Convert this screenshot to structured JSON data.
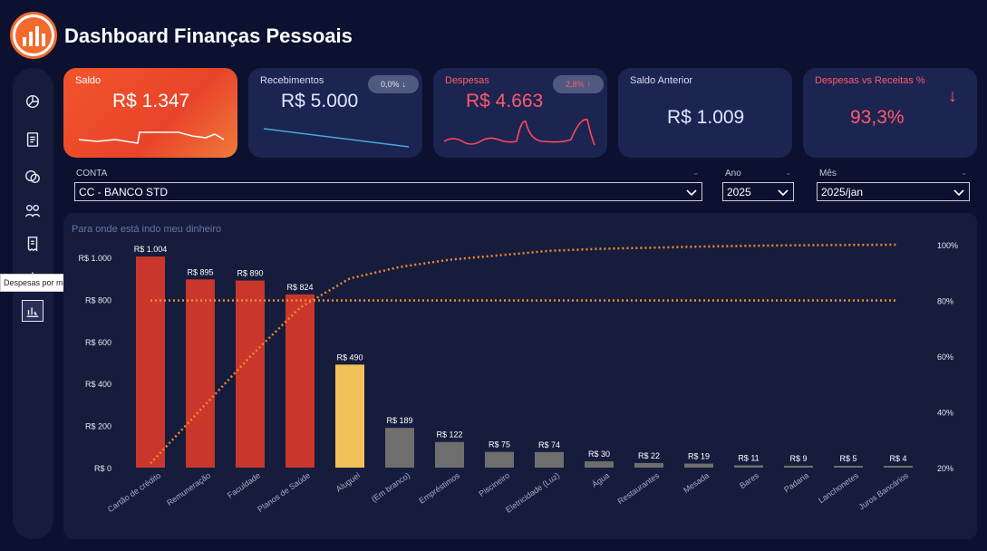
{
  "header": {
    "title": "Dashboard Finanças Pessoais",
    "logo_icon": "chart-logo-icon"
  },
  "sidebar": {
    "icons": [
      "pie-chart-icon",
      "document-icon",
      "coins-icon",
      "people-money-icon",
      "receipt-icon",
      "bar-chart-icon",
      "monthly-expenses-icon"
    ],
    "tooltip": "Despesas por mês"
  },
  "cards": {
    "saldo": {
      "label": "Saldo",
      "value": "R$ 1.347"
    },
    "recebimentos": {
      "label": "Recebimentos",
      "value": "R$ 5.000",
      "badge": "0,0%",
      "badge_icon": "arrow-down-icon"
    },
    "despesas": {
      "label": "Despesas",
      "value": "R$ 4.663",
      "badge": "2,8%",
      "badge_icon": "arrow-up-icon"
    },
    "saldo_anterior": {
      "label": "Saldo Anterior",
      "value": "R$ 1.009"
    },
    "despesas_receitas": {
      "label": "Despesas vs Receitas %",
      "value": "93,3%",
      "icon": "arrow-down-icon"
    }
  },
  "filters": {
    "conta": {
      "label": "CONTA",
      "value": "CC - BANCO STD"
    },
    "ano": {
      "label": "Ano",
      "value": "2025"
    },
    "mes": {
      "label": "Mês",
      "value": "2025/jan"
    }
  },
  "colors": {
    "accent": "#f26a2c",
    "bar_red": "#c9372c",
    "bar_yellow": "#f2c25a",
    "bar_gray": "#6e6e6e",
    "line": "#f08a2c",
    "panel": "#161c3c"
  },
  "chart_data": {
    "type": "bar",
    "title": "Para onde está indo meu dinheiro",
    "categories": [
      "Cartão de crédito",
      "Remuneração",
      "Faculdade",
      "Planos de Saúde",
      "Aluguel",
      "(Em branco)",
      "Empréstimos",
      "Piscineiro",
      "Eletricidade (Luz)",
      "Água",
      "Restaurantes",
      "Mesada",
      "Bares",
      "Padaria",
      "Lanchonetes",
      "Juros Bancários"
    ],
    "values": [
      1004,
      895,
      890,
      824,
      490,
      189,
      122,
      75,
      74,
      30,
      22,
      19,
      11,
      9,
      5,
      4
    ],
    "data_labels": [
      "R$ 1.004",
      "R$ 895",
      "R$ 890",
      "R$ 824",
      "R$ 490",
      "R$ 189",
      "R$ 122",
      "R$ 75",
      "R$ 74",
      "R$ 30",
      "R$ 22",
      "R$ 19",
      "R$ 11",
      "R$ 9",
      "R$ 5",
      "R$ 4"
    ],
    "bar_colors": [
      "red",
      "red",
      "red",
      "red",
      "yellow",
      "gray",
      "gray",
      "gray",
      "gray",
      "gray",
      "gray",
      "gray",
      "gray",
      "gray",
      "gray",
      "gray"
    ],
    "ylim": [
      0,
      1000
    ],
    "y_ticks": [
      "R$ 0",
      "R$ 200",
      "R$ 400",
      "R$ 600",
      "R$ 800",
      "R$ 1.000"
    ],
    "y2_ticks": [
      "20%",
      "40%",
      "60%",
      "80%",
      "100%"
    ],
    "y2lim": [
      20,
      100
    ],
    "cumulative_pct": [
      21.5,
      40.7,
      59.8,
      77.4,
      87.9,
      92.0,
      94.6,
      96.2,
      97.8,
      98.5,
      98.9,
      99.3,
      99.6,
      99.8,
      99.9,
      100.0
    ],
    "reference_line_pct": 80
  }
}
